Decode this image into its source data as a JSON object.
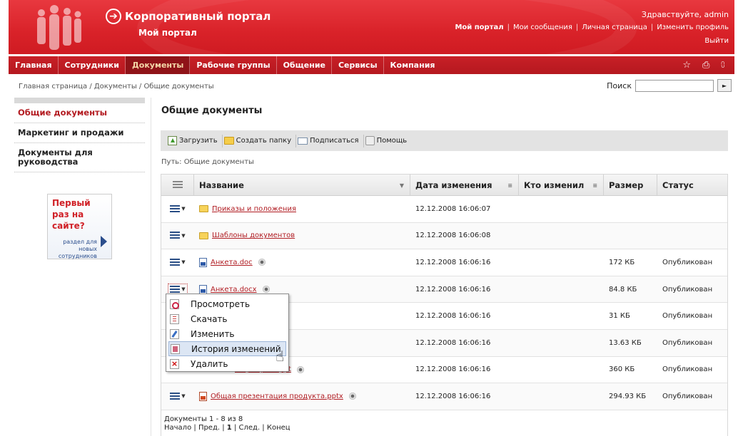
{
  "header": {
    "portal_title": "Корпоративный портал",
    "portal_subtitle": "Мой портал",
    "greeting": "Здравствуйте, admin",
    "links": [
      "Мой портал",
      "Мои сообщения",
      "Личная страница",
      "Изменить профиль"
    ],
    "logout": "Выйти"
  },
  "nav": {
    "items": [
      "Главная",
      "Сотрудники",
      "Документы",
      "Рабочие группы",
      "Общение",
      "Сервисы",
      "Компания"
    ],
    "active": "Документы",
    "icons": [
      "star-icon",
      "print-icon",
      "sitemap-icon"
    ]
  },
  "breadcrumb": "Главная страница / Документы / Общие документы",
  "search": {
    "label": "Поиск",
    "value": "",
    "go_symbol": "►"
  },
  "sidebar": {
    "items": [
      "Общие документы",
      "Маркетинг и продажи",
      "Документы для руководства"
    ],
    "active": "Общие документы"
  },
  "promo": {
    "headline": "Первый раз на сайте?",
    "caption": "раздел для новых сотрудников"
  },
  "main": {
    "title": "Общие документы",
    "toolbar": [
      "Загрузить",
      "Создать папку",
      "Подписаться",
      "Помощь"
    ],
    "path": "Путь: Общие документы"
  },
  "table": {
    "columns": [
      "Название",
      "Дата изменения",
      "Кто изменил",
      "Размер",
      "Статус"
    ],
    "rows": [
      {
        "name": "Приказы и положения",
        "type": "folder",
        "date": "12.12.2008 16:06:07",
        "who": "",
        "size": "",
        "status": ""
      },
      {
        "name": "Шаблоны документов",
        "type": "folder",
        "date": "12.12.2008 16:06:08",
        "who": "",
        "size": "",
        "status": ""
      },
      {
        "name": "Анкета.doc",
        "type": "doc",
        "date": "12.12.2008 16:06:16",
        "who": "",
        "size": "172 КБ",
        "status": "Опубликован"
      },
      {
        "name": "Анкета.docx",
        "type": "doc",
        "date": "12.12.2008 16:06:16",
        "who": "",
        "size": "84.8 КБ",
        "status": "Опубликован"
      },
      {
        "name": "",
        "type": "hidden",
        "date": "12.12.2008 16:06:16",
        "who": "",
        "size": "31 КБ",
        "status": "Опубликован"
      },
      {
        "name": "",
        "type": "hidden",
        "date": "12.12.2008 16:06:16",
        "who": "",
        "size": "13.63 КБ",
        "status": "Опубликован"
      },
      {
        "name": "я продукта.ppt",
        "type": "ppt-partial",
        "date": "12.12.2008 16:06:16",
        "who": "",
        "size": "360 КБ",
        "status": "Опубликован"
      },
      {
        "name": "Общая презентация продукта.pptx",
        "type": "ppt",
        "date": "12.12.2008 16:06:16",
        "who": "",
        "size": "294.93 КБ",
        "status": "Опубликован"
      }
    ],
    "footer_count": "Документы 1 - 8 из 8",
    "pager": {
      "start": "Начало",
      "prev": "Пред.",
      "current": "1",
      "next": "След.",
      "end": "Конец"
    }
  },
  "popup_menu": {
    "items": [
      "Просмотреть",
      "Скачать",
      "Изменить",
      "История изменений",
      "Удалить"
    ],
    "hovered": "История изменений"
  }
}
